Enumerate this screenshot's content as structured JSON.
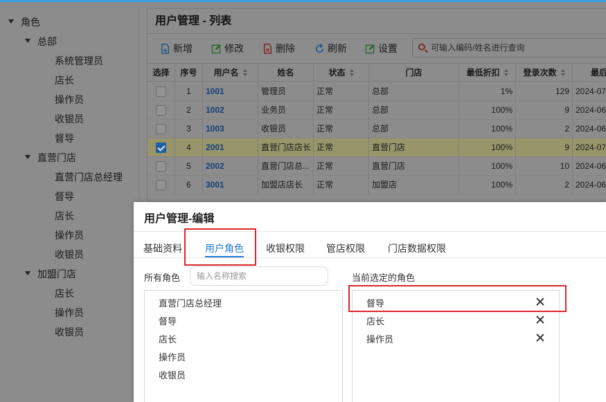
{
  "tree": {
    "root": "角色",
    "groups": [
      {
        "label": "总部",
        "items": [
          "系统管理员",
          "店长",
          "操作员",
          "收银员",
          "督导"
        ]
      },
      {
        "label": "直营门店",
        "items": [
          "直营门店总经理",
          "督导",
          "店长",
          "操作员",
          "收银员"
        ]
      },
      {
        "label": "加盟门店",
        "items": [
          "店长",
          "操作员",
          "收银员"
        ]
      }
    ]
  },
  "list": {
    "title": "用户管理 - 列表",
    "toolbar": {
      "add": "新增",
      "edit": "修改",
      "delete": "删除",
      "refresh": "刷新",
      "settings": "设置"
    },
    "search_placeholder": "可输入编码/姓名进行查询",
    "columns": [
      "选择",
      "序号",
      "用户名",
      "姓名",
      "状态",
      "门店",
      "最低折扣",
      "登录次数",
      "最后"
    ],
    "rows": [
      {
        "checked": false,
        "no": "1",
        "username": "1001",
        "name": "管理员",
        "status": "正常",
        "store": "总部",
        "discount": "1%",
        "logins": "129",
        "last": "2024-07-"
      },
      {
        "checked": false,
        "no": "2",
        "username": "1002",
        "name": "业务员",
        "status": "正常",
        "store": "总部",
        "discount": "100%",
        "logins": "9",
        "last": "2024-06-"
      },
      {
        "checked": false,
        "no": "3",
        "username": "1003",
        "name": "收银员",
        "status": "正常",
        "store": "总部",
        "discount": "100%",
        "logins": "2",
        "last": "2024-06-"
      },
      {
        "checked": true,
        "no": "4",
        "username": "2001",
        "name": "直营门店店长",
        "status": "正常",
        "store": "直营门店",
        "discount": "100%",
        "logins": "9",
        "last": "2024-07-"
      },
      {
        "checked": false,
        "no": "5",
        "username": "2002",
        "name": "直营门店总...",
        "status": "正常",
        "store": "直营门店",
        "discount": "100%",
        "logins": "10",
        "last": "2024-06-"
      },
      {
        "checked": false,
        "no": "6",
        "username": "3001",
        "name": "加盟店店长",
        "status": "正常",
        "store": "加盟店",
        "discount": "100%",
        "logins": "2",
        "last": "2024-06-"
      }
    ]
  },
  "dialog": {
    "title": "用户管理-编辑",
    "tabs": [
      "基础资料",
      "用户角色",
      "收银权限",
      "管店权限",
      "门店数据权限"
    ],
    "active_tab": "用户角色",
    "all_roles_label": "所有角色",
    "name_search_placeholder": "输入名称搜索",
    "selected_label": "当前选定的角色",
    "all_roles": [
      "直营门店总经理",
      "督导",
      "店长",
      "操作员",
      "收银员"
    ],
    "selected_roles": [
      "督导",
      "店长",
      "操作员"
    ]
  },
  "colors": {
    "accent": "#1e78d2",
    "highlight": "#d9262c",
    "topbar": "#3aa0e6"
  }
}
